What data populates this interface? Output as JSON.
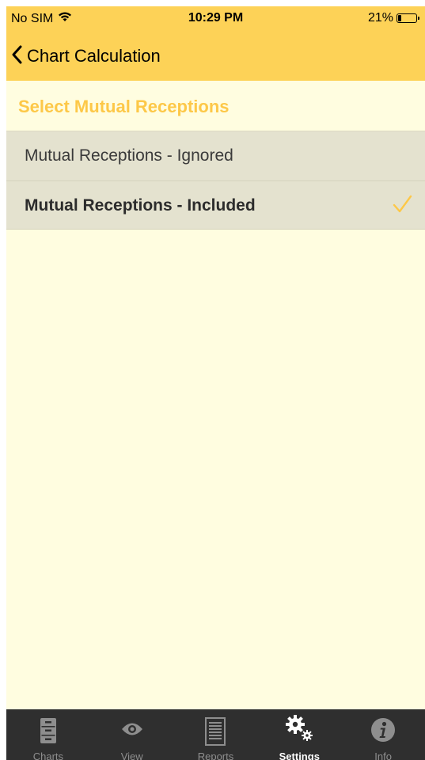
{
  "status_bar": {
    "carrier": "No SIM",
    "time": "10:29 PM",
    "battery": "21%",
    "battery_level": 0.21
  },
  "nav": {
    "back_label": "Chart Calculation"
  },
  "section": {
    "title": "Select Mutual Receptions"
  },
  "options": [
    {
      "label": "Mutual Receptions - Ignored",
      "selected": false
    },
    {
      "label": "Mutual Receptions - Included",
      "selected": true
    }
  ],
  "tabs": [
    {
      "label": "Charts",
      "icon": "cabinet-icon",
      "active": false
    },
    {
      "label": "View",
      "icon": "eye-icon",
      "active": false
    },
    {
      "label": "Reports",
      "icon": "document-icon",
      "active": false
    },
    {
      "label": "Settings",
      "icon": "gears-icon",
      "active": true
    },
    {
      "label": "Info",
      "icon": "info-icon",
      "active": false
    }
  ],
  "colors": {
    "header": "#fdd257",
    "accent": "#fdc848",
    "background": "#fffde0",
    "row": "#e4e2cf",
    "tabbar": "#2f2f2f"
  }
}
